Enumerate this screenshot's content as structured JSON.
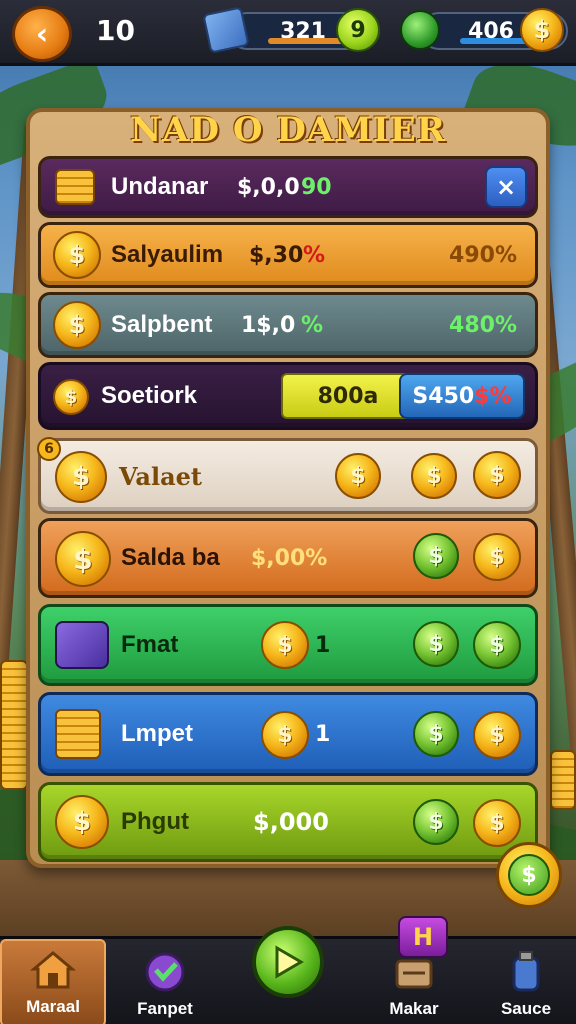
{
  "top_bar": {
    "level": "10",
    "resource_1_value": "321",
    "resource_1_badge": "9",
    "resource_2_value": "406",
    "resource_2_badge": "$"
  },
  "panel": {
    "title": "NAD O DAMIER",
    "rows": [
      {
        "name": "Undanar",
        "value": "$,0,0",
        "extra": "90",
        "pct": ""
      },
      {
        "name": "Salyaulim",
        "value": "$,30",
        "extra": "%",
        "pct": "490%"
      },
      {
        "name": "Salpbent",
        "value": "1$,0",
        "extra": "%",
        "pct": "480%"
      },
      {
        "name": "Soetiork",
        "value": "",
        "button_yellow": "800a",
        "button_blue": "S450",
        "button_blue_extra": "$%"
      },
      {
        "name": "Valaet",
        "badge": "6"
      },
      {
        "name": "Salda ba",
        "value": "$,00%"
      },
      {
        "name": "Fmat",
        "value": "1"
      },
      {
        "name": "Lmpet",
        "value": "1"
      },
      {
        "name": "Phgut",
        "value": "$,000"
      }
    ],
    "close_icon": "×"
  },
  "bottom_nav": {
    "items": [
      {
        "label": "Maraal"
      },
      {
        "label": "Fanpet"
      },
      {
        "label": ""
      },
      {
        "label": "Makar"
      },
      {
        "label": "Sauce"
      }
    ],
    "notification_glyph": "H"
  },
  "colors": {
    "gold": "#f6b81c",
    "green_coin": "#7cc837",
    "panel_wood": "#c9a066"
  }
}
